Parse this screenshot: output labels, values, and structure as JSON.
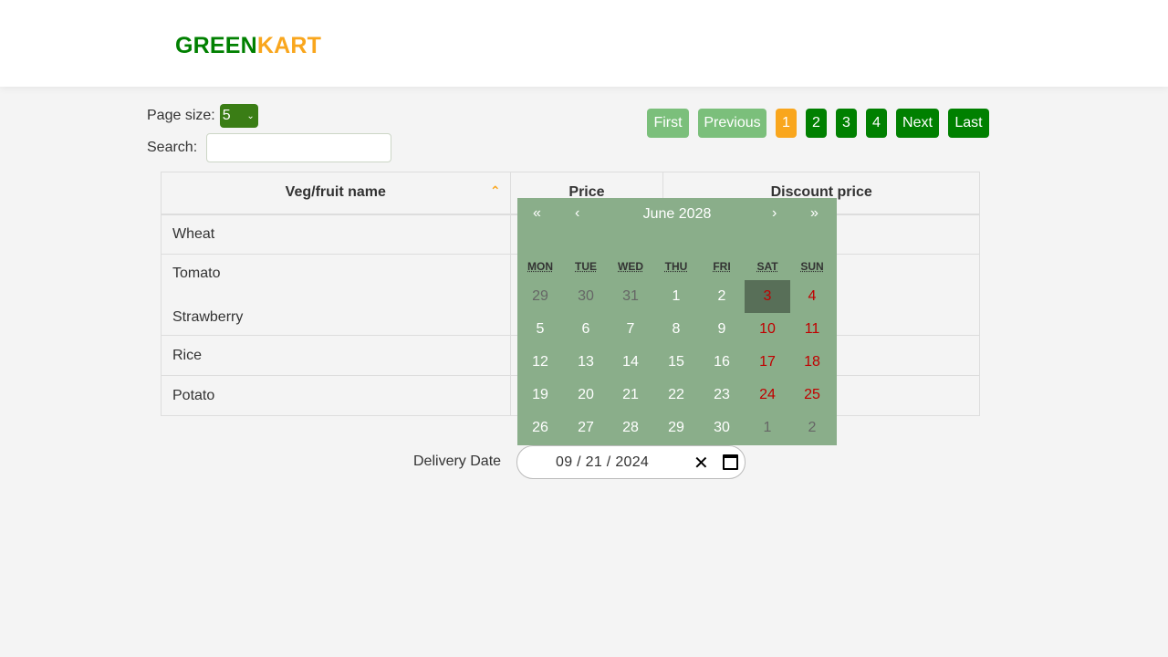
{
  "brand": {
    "part1": "GREEN",
    "part2": "KART"
  },
  "page_size": {
    "label": "Page size:",
    "value": "5"
  },
  "search": {
    "label": "Search:",
    "value": "",
    "placeholder": ""
  },
  "pagination": {
    "first": "First",
    "previous": "Previous",
    "pages": [
      "1",
      "2",
      "3",
      "4"
    ],
    "current": "1",
    "next": "Next",
    "last": "Last"
  },
  "table": {
    "headers": [
      "Veg/fruit name",
      "Price",
      "Discount price"
    ],
    "rows": [
      {
        "name": "Wheat"
      },
      {
        "name": "Tomato",
        "name2": "Strawberry"
      },
      {
        "name": "Rice"
      },
      {
        "name": "Potato"
      }
    ]
  },
  "calendar": {
    "title": "June 2028",
    "nav": {
      "prev_year": "«",
      "prev_month": "‹",
      "next_month": "›",
      "next_year": "»"
    },
    "weekdays": [
      "MON",
      "TUE",
      "WED",
      "THU",
      "FRI",
      "SAT",
      "SUN"
    ],
    "weeks": [
      [
        "29",
        "30",
        "31",
        "1",
        "2",
        "3",
        "4"
      ],
      [
        "5",
        "6",
        "7",
        "8",
        "9",
        "10",
        "11"
      ],
      [
        "12",
        "13",
        "14",
        "15",
        "16",
        "17",
        "18"
      ],
      [
        "19",
        "20",
        "21",
        "22",
        "23",
        "24",
        "25"
      ],
      [
        "26",
        "27",
        "28",
        "29",
        "30",
        "1",
        "2"
      ]
    ],
    "selected_day": "3"
  },
  "delivery": {
    "label": "Delivery Date",
    "month": "09",
    "day": "21",
    "year": "2024"
  },
  "colors": {
    "brand_green": "#008000",
    "brand_orange": "#f9a61d",
    "calendar_bg": "#8aae8a",
    "weekend_red": "#c00000"
  }
}
